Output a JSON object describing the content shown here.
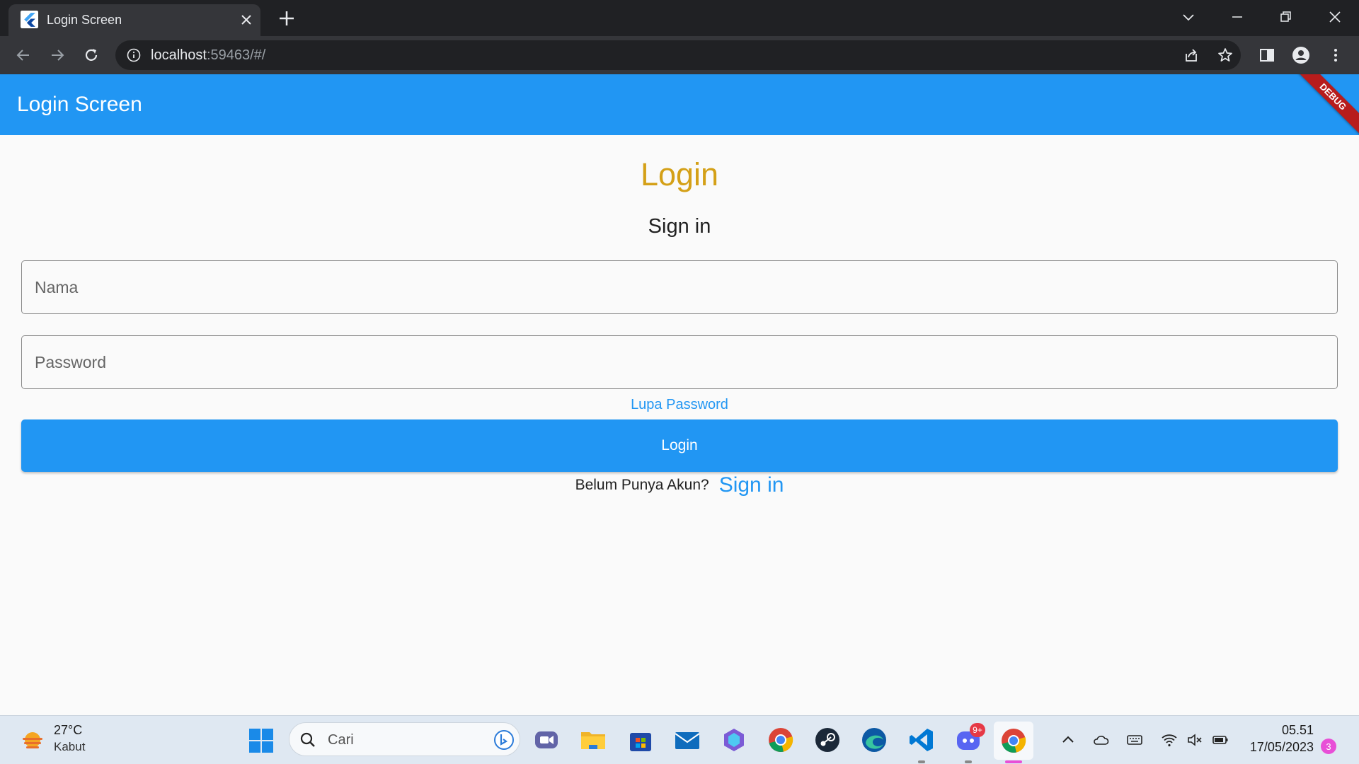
{
  "browser": {
    "tab_title": "Login Screen",
    "url_host": "localhost",
    "url_rest": ":59463/#/"
  },
  "app": {
    "appbar_title": "Login Screen",
    "debug_label": "DEBUG",
    "heading": "Login",
    "subheading": "Sign in",
    "name_placeholder": "Nama",
    "password_placeholder": "Password",
    "forgot_password": "Lupa Password",
    "login_button": "Login",
    "no_account_text": "Belum Punya Akun?",
    "signup_link": "Sign in",
    "colors": {
      "primary": "#2196f3",
      "heading": "#d4a017",
      "debug_banner": "#b71c1c"
    }
  },
  "taskbar": {
    "weather_temp": "27°C",
    "weather_desc": "Kabut",
    "search_placeholder": "Cari",
    "discord_badge": "9+",
    "time": "05.51",
    "date": "17/05/2023",
    "notification_count": "3",
    "apps": [
      "windows-start",
      "teams",
      "file-explorer",
      "microsoft-store",
      "mail",
      "microsoft-365",
      "chrome",
      "steam",
      "edge",
      "vscode",
      "discord",
      "chrome-active"
    ]
  }
}
